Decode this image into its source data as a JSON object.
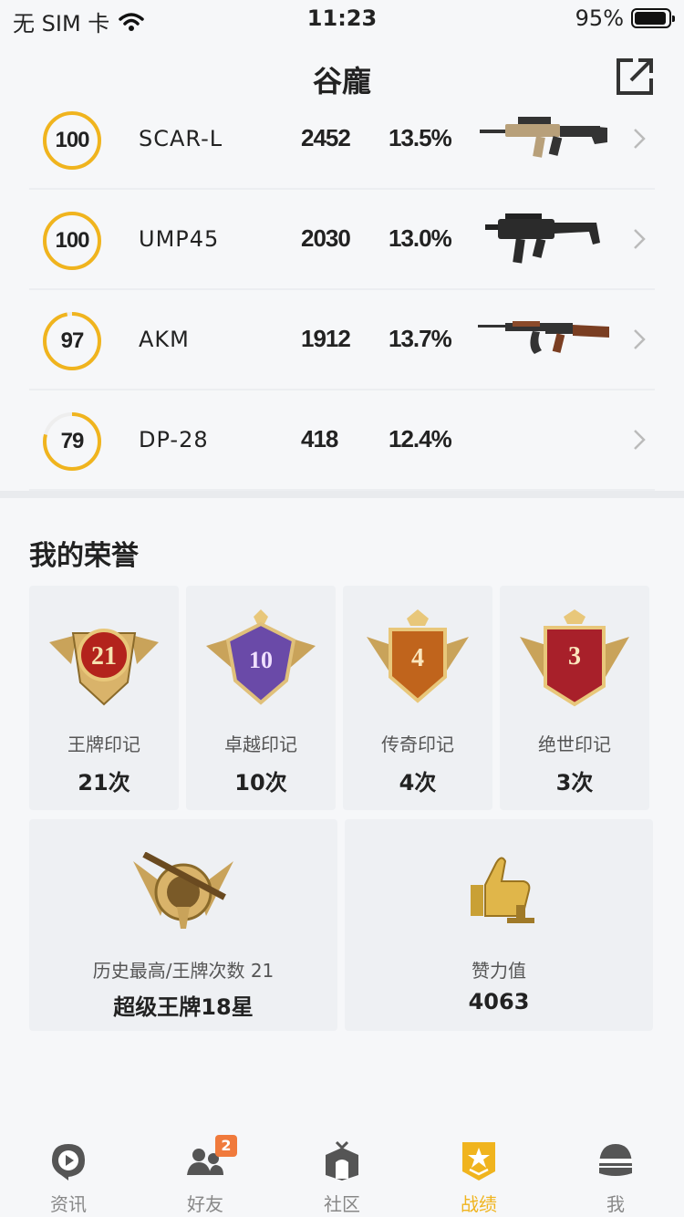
{
  "status_bar": {
    "carrier": "无 SIM 卡",
    "time": "11:23",
    "battery": "95%",
    "battery_level": 0.95
  },
  "nav": {
    "title": "谷龐"
  },
  "weapons": [
    {
      "score": "100",
      "progress": 1.0,
      "name": "SCAR-L",
      "count": "2452",
      "rate": "13.5%",
      "image": "scar-l-rifle"
    },
    {
      "score": "100",
      "progress": 1.0,
      "name": "UMP45",
      "count": "2030",
      "rate": "13.0%",
      "image": "ump45-smg"
    },
    {
      "score": "97",
      "progress": 0.97,
      "name": "AKM",
      "count": "1912",
      "rate": "13.7%",
      "image": "akm-rifle"
    },
    {
      "score": "79",
      "progress": 0.79,
      "name": "DP-28",
      "count": "418",
      "rate": "12.4%",
      "image": ""
    }
  ],
  "honor": {
    "title": "我的荣誉",
    "marks": [
      {
        "number": "21",
        "label": "王牌印记",
        "count": "21次",
        "color": "#b3231c"
      },
      {
        "number": "10",
        "label": "卓越印记",
        "count": "10次",
        "color": "#6a4aa8"
      },
      {
        "number": "4",
        "label": "传奇印记",
        "count": "4次",
        "color": "#c0641c"
      },
      {
        "number": "3",
        "label": "绝世印记",
        "count": "3次",
        "color": "#a8202a"
      }
    ],
    "rank": {
      "label": "历史最高/王牌次数 21",
      "value": "超级王牌18星"
    },
    "likes": {
      "label": "赞力值",
      "value": "4063"
    }
  },
  "tabs": [
    {
      "label": "资讯",
      "icon": "news-icon",
      "active": false
    },
    {
      "label": "好友",
      "icon": "friends-icon",
      "active": false,
      "badge": "2"
    },
    {
      "label": "社区",
      "icon": "community-icon",
      "active": false
    },
    {
      "label": "战绩",
      "icon": "record-icon",
      "active": true
    },
    {
      "label": "我",
      "icon": "helmet-icon",
      "active": false
    }
  ],
  "colors": {
    "accent": "#f0b41e",
    "ring_track": "#eeeeee"
  }
}
